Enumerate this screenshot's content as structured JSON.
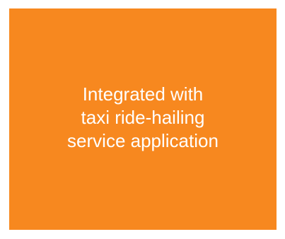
{
  "tile": {
    "background_color": "#F7881F",
    "text_color": "#FFFFFF",
    "lines": [
      "Integrated with",
      "taxi ride-hailing",
      " service application"
    ]
  }
}
